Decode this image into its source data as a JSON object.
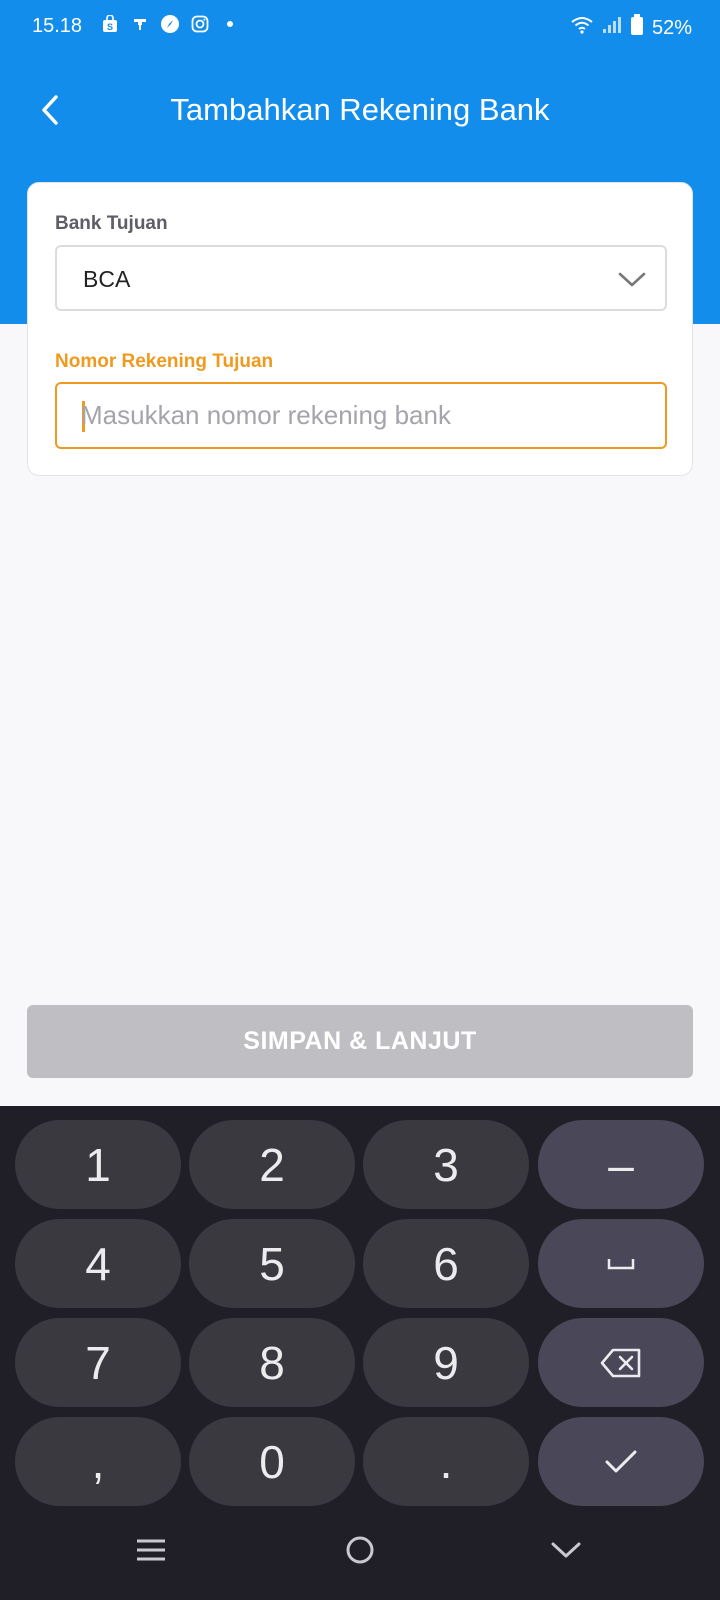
{
  "status_bar": {
    "time": "15.18",
    "battery": "52%",
    "left_icons": [
      "shopping-bag-icon",
      "hanger-icon",
      "compass-icon",
      "instagram-icon",
      "dot-icon"
    ],
    "right_icons": [
      "wifi-icon",
      "signal-icon",
      "battery-icon"
    ]
  },
  "header": {
    "title": "Tambahkan Rekening Bank",
    "back_icon": "chevron-left-icon"
  },
  "form": {
    "bank_label": "Bank Tujuan",
    "bank_value": "BCA",
    "account_label": "Nomor Rekening Tujuan",
    "account_placeholder": "Masukkan nomor rekening bank",
    "account_value": ""
  },
  "actions": {
    "save_label": "SIMPAN & LANJUT"
  },
  "keyboard": {
    "rows": [
      [
        "1",
        "2",
        "3",
        "–"
      ],
      [
        "4",
        "5",
        "6",
        "␣"
      ],
      [
        "7",
        "8",
        "9",
        "⌫"
      ],
      [
        ",",
        "0",
        ".",
        "✓"
      ]
    ]
  },
  "colors": {
    "primary_blue": "#138deb",
    "accent_orange": "#ef9a1f",
    "disabled_button": "#bfbec3",
    "keyboard_bg": "#201f27"
  }
}
